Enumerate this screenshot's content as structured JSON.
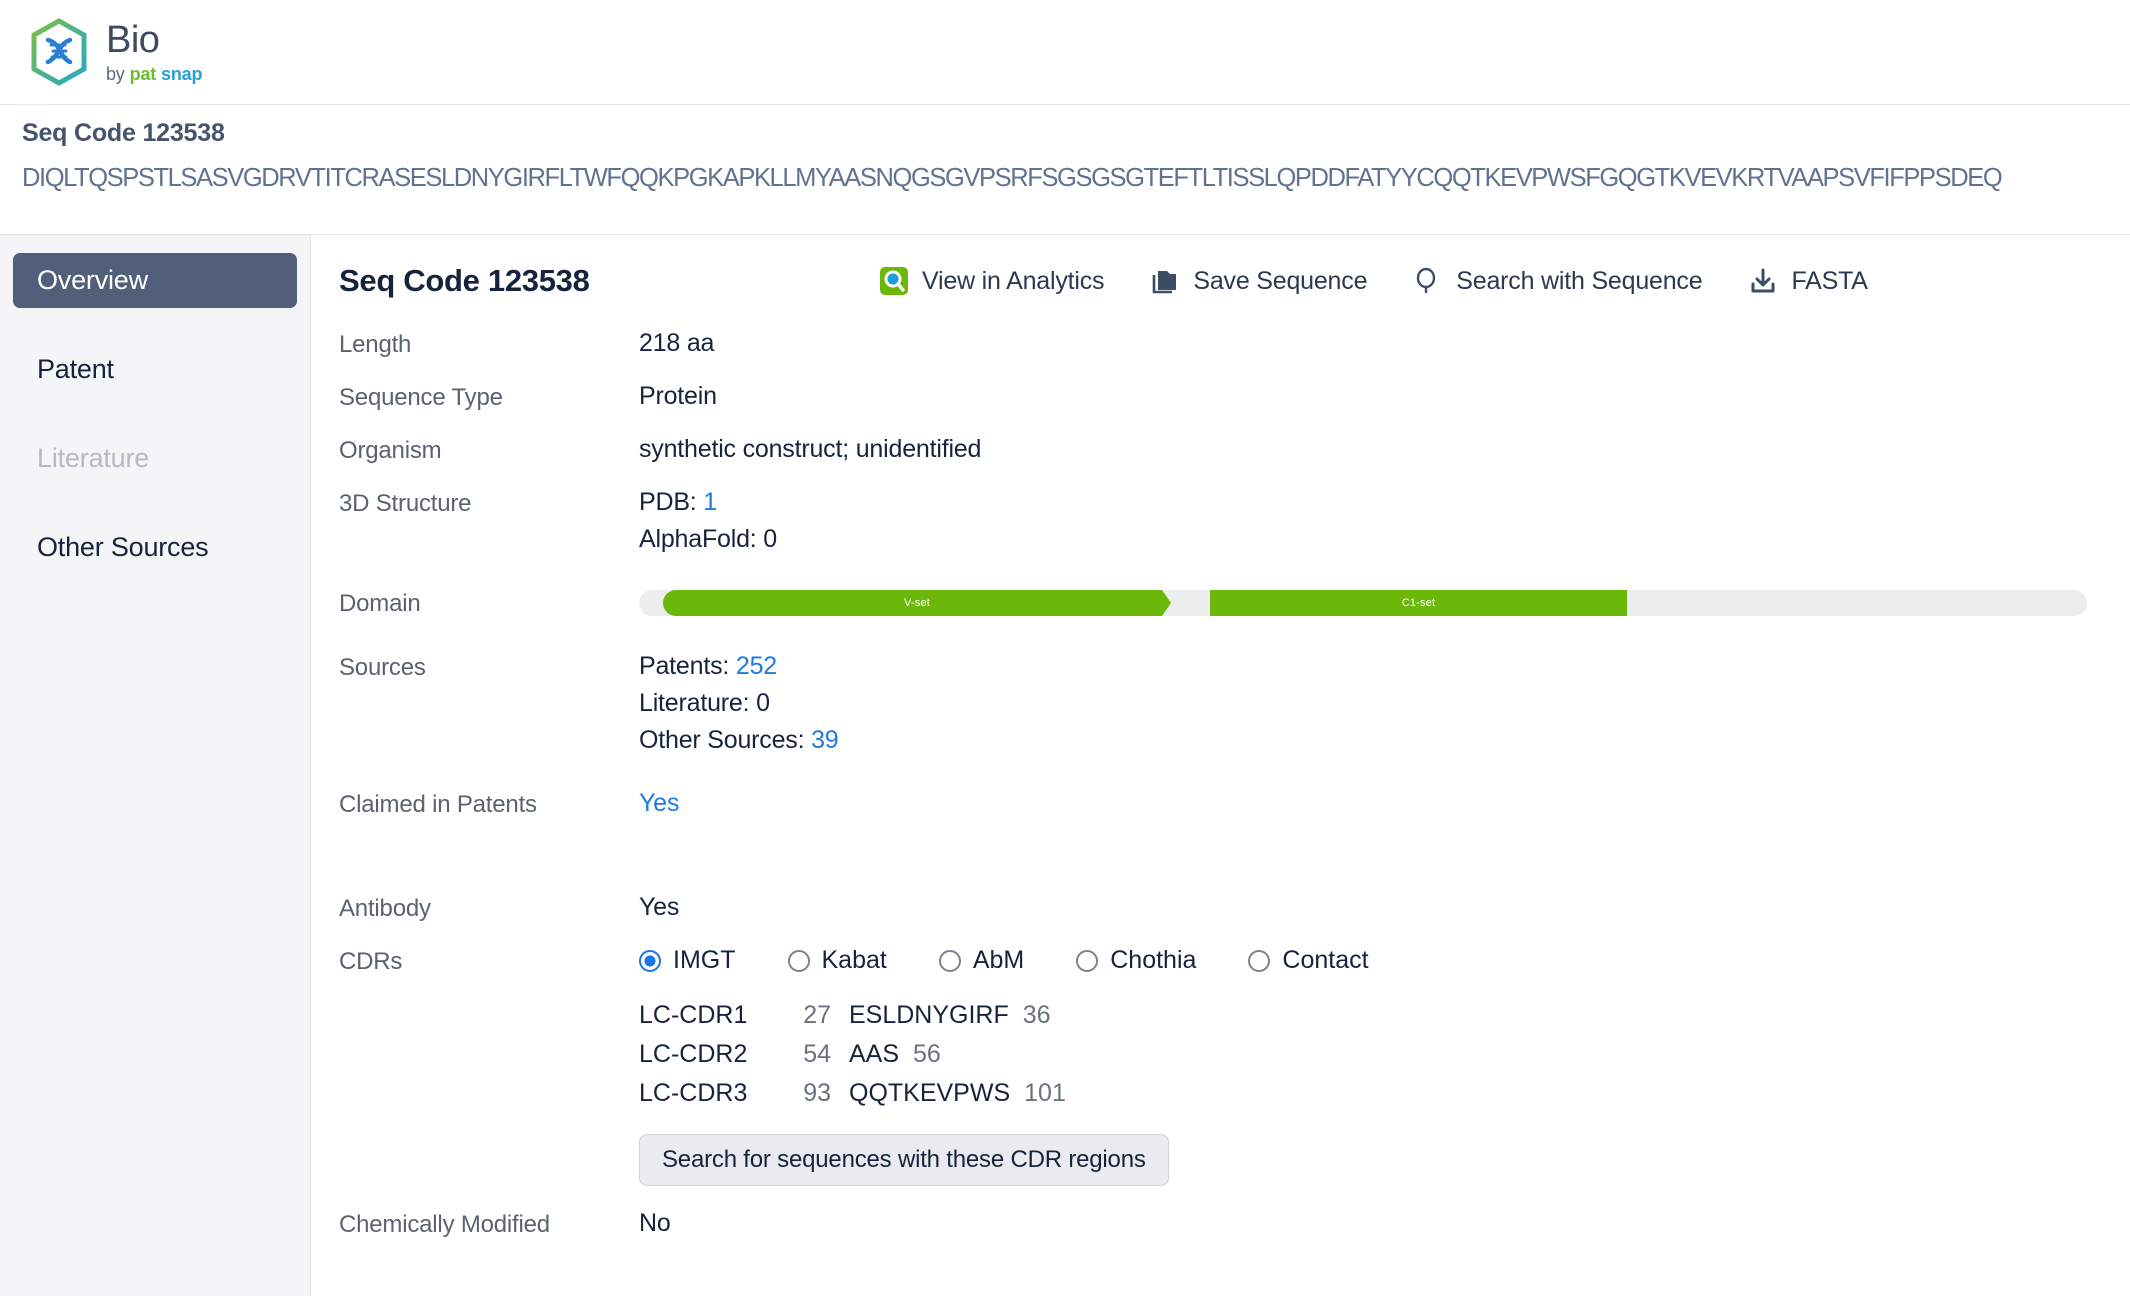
{
  "brand": {
    "name": "Bio",
    "by": "by",
    "pat": "pat",
    "snap": "snap",
    "logo_icon": "dna-hexagon-icon"
  },
  "seq_header": {
    "title": "Seq Code 123538",
    "sequence": "DIQLTQSPSTLSASVGDRVTITCRASESLDNYGIRFLTWFQQKPGKAPKLLMYAASNQGSGVPSRFSGSGSGTEFTLTISSLQPDDFATYYCQQTKEVPWSFGQGTKVEVKRTVAAPSVFIFPPSDEQ"
  },
  "sidebar": {
    "items": [
      {
        "label": "Overview",
        "state": "active"
      },
      {
        "label": "Patent",
        "state": "normal"
      },
      {
        "label": "Literature",
        "state": "disabled"
      },
      {
        "label": "Other Sources",
        "state": "normal"
      }
    ]
  },
  "main": {
    "title": "Seq Code 123538",
    "actions": [
      {
        "label": "View in Analytics",
        "icon": "analytics-search-icon"
      },
      {
        "label": "Save Sequence",
        "icon": "folder-save-icon"
      },
      {
        "label": "Search with Sequence",
        "icon": "magnifier-icon"
      },
      {
        "label": "FASTA",
        "icon": "download-icon"
      }
    ],
    "fields": {
      "length_label": "Length",
      "length_value": "218 aa",
      "sequence_type_label": "Sequence Type",
      "sequence_type_value": "Protein",
      "organism_label": "Organism",
      "organism_value": "synthetic construct; unidentified",
      "structure_label": "3D Structure",
      "structure_pdb_text": "PDB: ",
      "structure_pdb_count": "1",
      "structure_alphafold": "AlphaFold: 0",
      "domain_label": "Domain",
      "sources_label": "Sources",
      "sources_patents_text": "Patents: ",
      "sources_patents_count": "252",
      "sources_literature": "Literature: 0",
      "sources_other_text": "Other Sources: ",
      "sources_other_count": "39",
      "claimed_label": "Claimed in Patents",
      "claimed_value": "Yes",
      "antibody_label": "Antibody",
      "antibody_value": "Yes",
      "cdrs_label": "CDRs",
      "chemically_modified_label": "Chemically Modified",
      "chemically_modified_value": "No"
    },
    "domain": {
      "segments": [
        {
          "label": "V-set",
          "color": "#6cb80a"
        },
        {
          "label": "C1-set",
          "color": "#6cb80a"
        }
      ],
      "track_color": "#eceded"
    },
    "cdr_schemes": [
      {
        "label": "IMGT",
        "selected": true
      },
      {
        "label": "Kabat",
        "selected": false
      },
      {
        "label": "AbM",
        "selected": false
      },
      {
        "label": "Chothia",
        "selected": false
      },
      {
        "label": "Contact",
        "selected": false
      }
    ],
    "cdr_rows": [
      {
        "name": "LC-CDR1",
        "start": "27",
        "seq": "ESLDNYGIRF",
        "end": "36"
      },
      {
        "name": "LC-CDR2",
        "start": "54",
        "seq": "AAS",
        "end": "56"
      },
      {
        "name": "LC-CDR3",
        "start": "93",
        "seq": "QQTKEVPWS",
        "end": "101"
      }
    ],
    "cdr_search_button": "Search for sequences with these CDR regions"
  },
  "colors": {
    "accent_link": "#1f7ae0",
    "domain_green": "#6cb80a",
    "sidebar_active": "#525f7a",
    "radio_selected": "#1a73e8"
  }
}
